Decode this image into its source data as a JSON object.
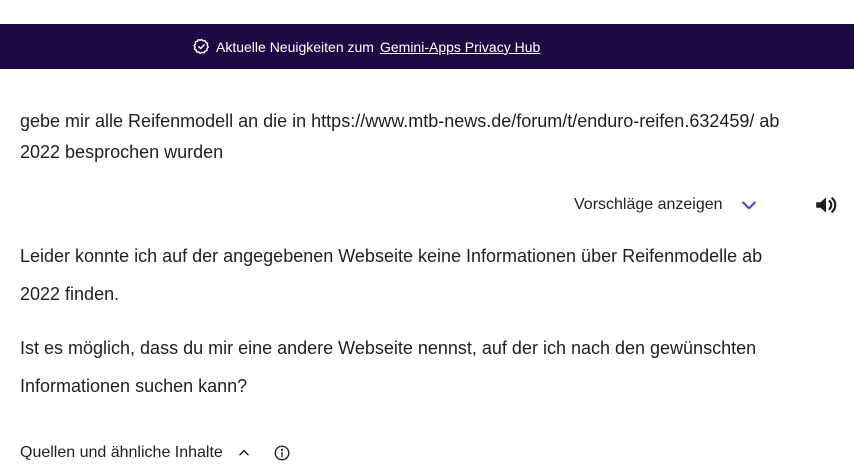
{
  "banner": {
    "icon": "verified-check-icon",
    "text": "Aktuelle Neuigkeiten zum ",
    "link_text": "Gemini-Apps Privacy Hub",
    "background": "#1d0a45"
  },
  "prompt": {
    "text": "gebe mir alle Reifenmodell an die in https://www.mtb-news.de/forum/t/enduro-reifen.632459/ ab 2022 besprochen wurden"
  },
  "response_toolbar": {
    "suggestions_label": "Vorschläge anzeigen",
    "chevron_icon": "chevron-down-icon",
    "chevron_color": "#6b2fd1",
    "speaker_icon": "speaker-icon"
  },
  "response": {
    "paragraphs": [
      "Leider konnte ich auf der angegebenen Webseite keine Informationen über Reifenmodelle ab 2022 finden.",
      "Ist es möglich, dass du mir eine andere Webseite nennst, auf der ich nach den gewünschten Informationen suchen kann?"
    ]
  },
  "sources": {
    "label": "Quellen und ähnliche Inhalte",
    "chevron_icon": "chevron-up-icon",
    "info_icon": "info-icon"
  }
}
